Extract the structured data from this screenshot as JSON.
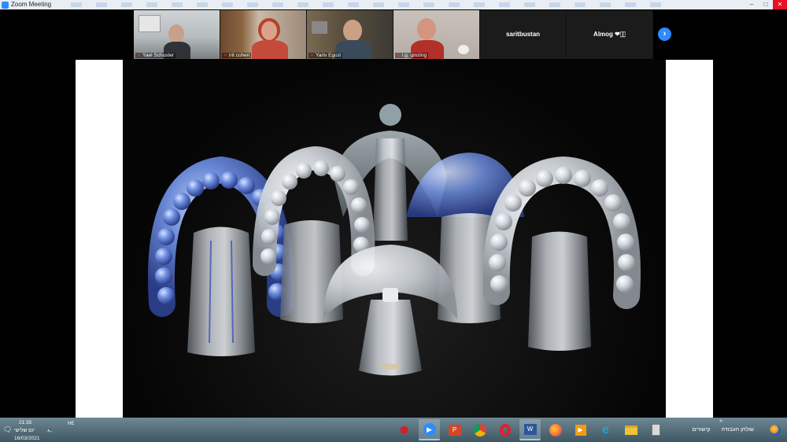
{
  "window": {
    "title": "Zoom Meeting"
  },
  "participants": [
    {
      "name": "Yael Schuster",
      "muted": true,
      "video": true
    },
    {
      "name": "irit cohen",
      "muted": true,
      "video": true
    },
    {
      "name": "Yariv Egozi",
      "muted": true,
      "video": true
    },
    {
      "name": "i.g. ginzing",
      "muted": true,
      "video": true
    },
    {
      "name": "saritbustan",
      "muted": false,
      "video": false
    },
    {
      "name": "Almog ❤‏🇮‏",
      "muted": false,
      "video": false
    }
  ],
  "next_page_icon": "chevron-right-icon",
  "shared_content": {
    "description_icon": "perfume-bottles-photo",
    "colors": {
      "blue_glass": "#5a7fd8",
      "frost_glass": "#d8dde3",
      "background": "#050505"
    }
  },
  "taskbar": {
    "time": "21:35",
    "day": "יום שלישי",
    "date": "16/03/2021",
    "language": "HE",
    "apps": [
      {
        "icon": "mcafee-icon",
        "active": false
      },
      {
        "icon": "zoom-icon",
        "active": true
      },
      {
        "icon": "powerpoint-icon",
        "active": false
      },
      {
        "icon": "chrome-icon",
        "active": false
      },
      {
        "icon": "opera-icon",
        "active": false
      },
      {
        "icon": "word-icon",
        "active": true
      },
      {
        "icon": "firefox-icon",
        "active": false
      },
      {
        "icon": "media-player-icon",
        "active": false
      },
      {
        "icon": "internet-explorer-icon",
        "active": false
      },
      {
        "icon": "file-explorer-icon",
        "active": false
      },
      {
        "icon": "calculator-icon",
        "active": false
      }
    ],
    "search_label": "קישורים",
    "desktop_label": "שולחן העבודה"
  }
}
